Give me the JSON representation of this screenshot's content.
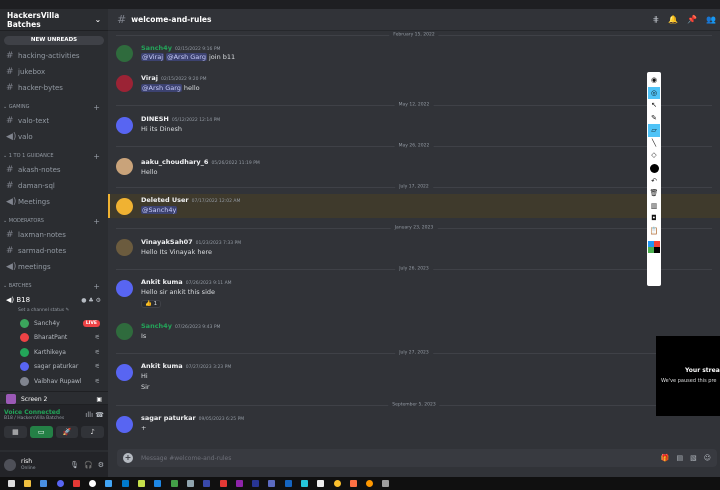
{
  "server": {
    "name": "HackersVilla Batches",
    "new_unreads": "NEW UNREADS"
  },
  "channels_top": [
    "hacking-activities",
    "jukebox",
    "hacker-bytes"
  ],
  "categories": {
    "gaming": "GAMING",
    "one_to_one": "1 TO 1 GUIDANCE",
    "moderators": "MODERATORS",
    "batches": "BATCHES"
  },
  "gaming_channels": [
    {
      "label": "valo-text",
      "icon": "#"
    },
    {
      "label": "valo",
      "icon": "🔊"
    }
  ],
  "guidance_channels": [
    {
      "label": "akash-notes",
      "icon": "#"
    },
    {
      "label": "daman-sql",
      "icon": "#"
    },
    {
      "label": "Meetings",
      "icon": "🔊"
    }
  ],
  "moderator_channels": [
    {
      "label": "laxman-notes",
      "icon": "#"
    },
    {
      "label": "sarmad-notes",
      "icon": "#"
    },
    {
      "label": "meetings",
      "icon": "🔊"
    }
  ],
  "voice_channel": {
    "name": "B18",
    "status": "Set a channel status ✎",
    "users": [
      "Sanch4y",
      "BharatPant",
      "Karthikeya",
      "sagar paturkar",
      "Vaibhav Rupawl"
    ],
    "live_label": "LIVE"
  },
  "screen_share": {
    "label": "Screen 2"
  },
  "voice_panel": {
    "status": "Voice Connected",
    "sub": "B18 / HackersVilla Batches"
  },
  "user_panel": {
    "name": "rish",
    "status": "Online"
  },
  "channel": {
    "name": "welcome-and-rules"
  },
  "dividers": [
    "February 15, 2022",
    "May 12, 2022",
    "May 26, 2022",
    "July 17, 2022",
    "January 23, 2023",
    "July 26, 2023",
    "July 27, 2023",
    "September 5, 2023"
  ],
  "messages": [
    {
      "author": "Sanch4y",
      "ts": "02/15/2022 9:16 PM",
      "mentions": [
        "@Viraj",
        "@Arsh Garg"
      ],
      "text": "join b11",
      "color": "#23a559"
    },
    {
      "author": "Viraj",
      "ts": "02/15/2022 9:20 PM",
      "mentions": [
        "@Arsh Garg"
      ],
      "text": "hello",
      "color": "#f2f3f5"
    },
    {
      "author": "DINESH",
      "ts": "05/12/2022 12:14 PM",
      "text": "Hi its Dinesh",
      "color": "#f2f3f5"
    },
    {
      "author": "aaku_choudhary_6",
      "ts": "05/26/2022 11:19 PM",
      "text": "Hello",
      "color": "#f2f3f5"
    },
    {
      "author": "Deleted User",
      "ts": "07/17/2022 12:02 AM",
      "mentions": [
        "@Sanch4y"
      ],
      "text": "",
      "color": "#f2f3f5"
    },
    {
      "author": "VinayakSah07",
      "ts": "01/23/2023 7:33 PM",
      "text": "Hello Its Vinayak here",
      "color": "#f2f3f5"
    },
    {
      "author": "Ankit kuma",
      "ts": "07/26/2023 9:11 AM",
      "text": "Hello sir ankit this side",
      "reaction": "👍 1",
      "color": "#f2f3f5"
    },
    {
      "author": "Sanch4y",
      "ts": "07/26/2023 9:43 PM",
      "text": "Is",
      "color": "#23a559"
    },
    {
      "author": "Ankit kuma",
      "ts": "07/27/2023 3:23 PM",
      "text": "Hi",
      "text2": "Sir",
      "color": "#f2f3f5"
    },
    {
      "author": "sagar paturkar",
      "ts": "09/05/2023 6:25 PM",
      "text": "+",
      "color": "#f2f3f5"
    }
  ],
  "composer": {
    "placeholder": "Message #welcome-and-rules"
  },
  "stream_overlay": {
    "title": "Your strea",
    "subtitle": "We've paused this pre"
  },
  "colors": {
    "blurple": "#5865f2",
    "online": "#23a559",
    "live": "#ed4245",
    "highlight_bar": "#f0b232"
  }
}
